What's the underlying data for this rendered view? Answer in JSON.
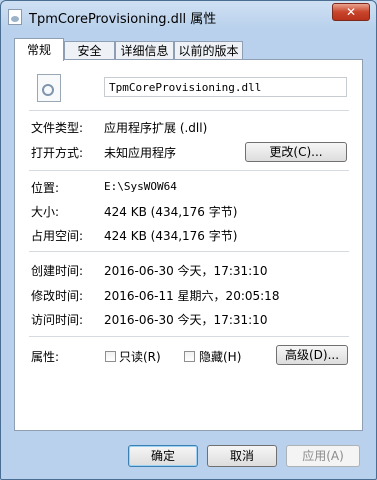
{
  "window": {
    "title": "TpmCoreProvisioning.dll 属性",
    "close_glyph": "✕"
  },
  "tabs": [
    {
      "label": "常规",
      "active": true
    },
    {
      "label": "安全",
      "active": false
    },
    {
      "label": "详细信息",
      "active": false
    },
    {
      "label": "以前的版本",
      "active": false
    }
  ],
  "general": {
    "filename": "TpmCoreProvisioning.dll",
    "file_type_label": "文件类型:",
    "file_type_value": "应用程序扩展 (.dll)",
    "opens_with_label": "打开方式:",
    "opens_with_value": "未知应用程序",
    "change_button": "更改(C)...",
    "location_label": "位置:",
    "location_value": "E:\\SysWOW64",
    "size_label": "大小:",
    "size_value": "424 KB (434,176 字节)",
    "size_on_disk_label": "占用空间:",
    "size_on_disk_value": "424 KB (434,176 字节)",
    "created_label": "创建时间:",
    "created_value": "2016-06-30 今天，17:31:10",
    "modified_label": "修改时间:",
    "modified_value": "2016-06-11 星期六，20:05:18",
    "accessed_label": "访问时间:",
    "accessed_value": "2016-06-30 今天，17:31:10",
    "attributes_label": "属性:",
    "readonly_label": "只读(R)",
    "readonly_checked": false,
    "hidden_label": "隐藏(H)",
    "hidden_checked": false,
    "advanced_button": "高级(D)..."
  },
  "footer": {
    "ok_button": "确定",
    "cancel_button": "取消",
    "apply_button": "应用(A)"
  },
  "colors": {
    "frame": "#b9d1ec",
    "close_button": "#c8442b"
  },
  "icons": {
    "title": "file-icon",
    "file": "dll-file-icon"
  }
}
